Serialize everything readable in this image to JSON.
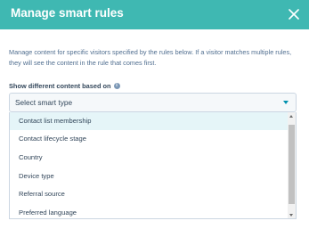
{
  "header": {
    "title": "Manage smart rules",
    "close_icon": "close-icon",
    "background_color": "#3fb8b2"
  },
  "description": "Manage content for specific visitors specified by the rules below. If a visitor matches multiple rules, they will see the content in the rule that comes first.",
  "field": {
    "label": "Show different content based on",
    "info_icon": "info-icon"
  },
  "select": {
    "placeholder": "Select smart type",
    "options": [
      "Contact list membership",
      "Contact lifecycle stage",
      "Country",
      "Device type",
      "Referral source",
      "Preferred language"
    ],
    "highlighted_index": 0
  }
}
